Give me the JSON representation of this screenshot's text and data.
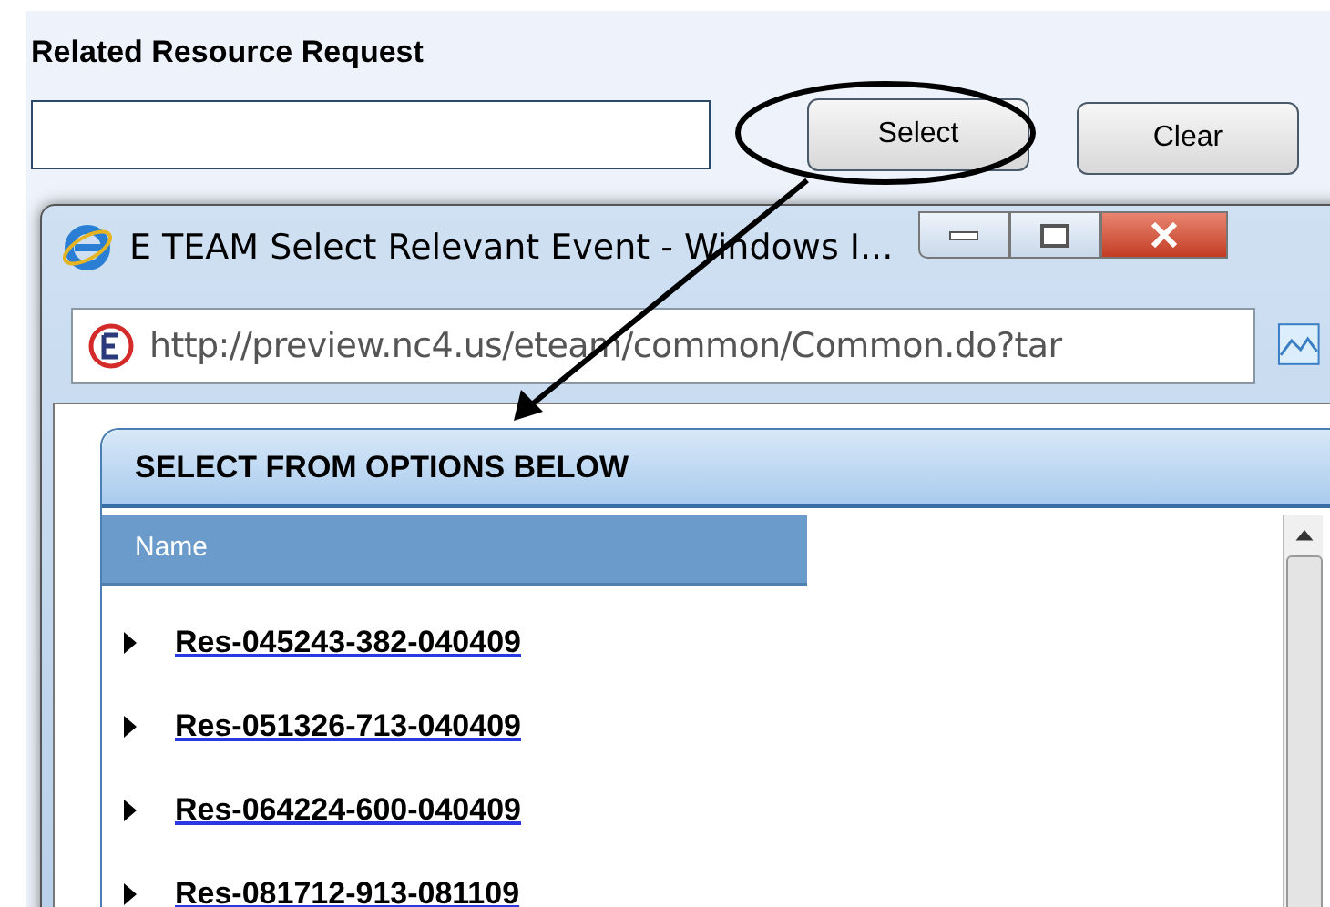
{
  "form": {
    "label": "Related Resource Request",
    "buttons": [
      "Select",
      "Clear"
    ]
  },
  "popup": {
    "title": "E TEAM Select Relevant Event - Windows I...",
    "address": "http://preview.nc4.us/eteam/common/Common.do?tar",
    "panel_title": "SELECT FROM OPTIONS BELOW",
    "column": "Name",
    "rows": [
      {
        "name": "Res-045243-382-040409"
      },
      {
        "name": "Res-051326-713-040409"
      },
      {
        "name": "Res-064224-600-040409"
      },
      {
        "name": "Res-081712-913-081109"
      }
    ]
  }
}
